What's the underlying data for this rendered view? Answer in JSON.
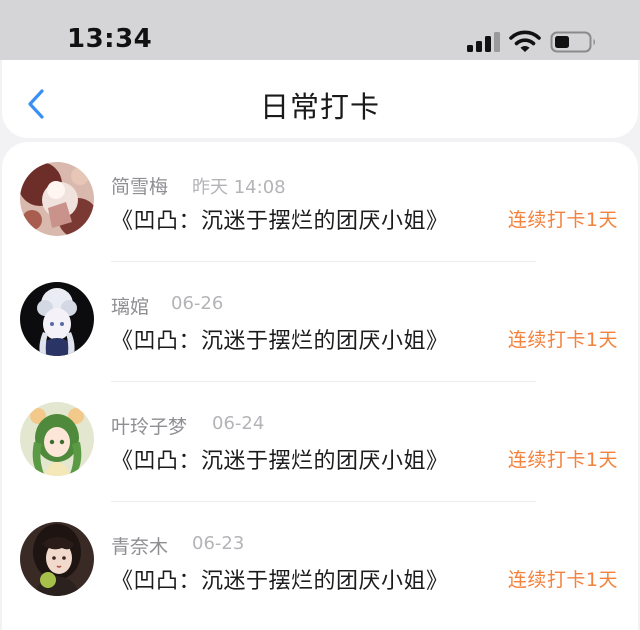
{
  "status_bar": {
    "time": "13:34"
  },
  "nav": {
    "back_icon": "chevron-left-icon",
    "title": "日常打卡"
  },
  "colors": {
    "accent_orange": "#f3823d",
    "back_blue": "#3b8ff3",
    "name_gray": "#8e8e93",
    "time_gray": "#b4b4b8",
    "background": "#f2f2f5"
  },
  "checkins": [
    {
      "name": "简雪梅",
      "time": "昨天 14:08",
      "book": "《凹凸：沉迷于摆烂的团厌小姐》",
      "streak": "连续打卡1天"
    },
    {
      "name": "璃婠",
      "time": "06-26",
      "book": "《凹凸：沉迷于摆烂的团厌小姐》",
      "streak": "连续打卡1天"
    },
    {
      "name": "叶玲子梦",
      "time": "06-24",
      "book": "《凹凸：沉迷于摆烂的团厌小姐》",
      "streak": "连续打卡1天"
    },
    {
      "name": "青奈木",
      "time": "06-23",
      "book": "《凹凸：沉迷于摆烂的团厌小姐》",
      "streak": "连续打卡1天"
    }
  ]
}
